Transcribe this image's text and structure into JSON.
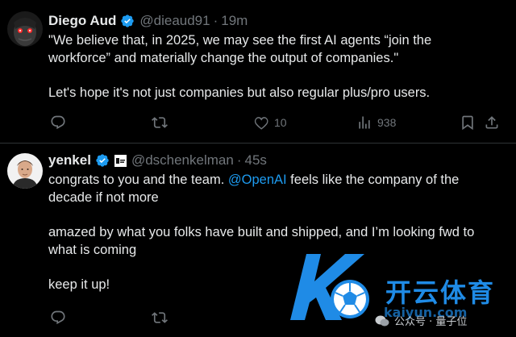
{
  "tweets": [
    {
      "display_name": "Diego Aud",
      "handle": "@dieaud91",
      "time": "19m",
      "lines": [
        "\"We believe that, in 2025, we may see the first AI agents “join the",
        "workforce” and materially change the output of companies.\"",
        "",
        "Let's hope it's not just companies but also regular plus/pro users."
      ],
      "actions": {
        "replies": "",
        "retweets": "",
        "likes": "10",
        "views": "938"
      },
      "icons": [
        "reply-icon",
        "retweet-icon",
        "like-icon",
        "views-icon",
        "bookmark-icon",
        "share-icon"
      ]
    },
    {
      "display_name": "yenkel",
      "handle": "@dschenkelman",
      "time": "45s",
      "line1_prefix": "congrats to you and the team. ",
      "line1_mention": "@OpenAI",
      "line1_suffix": " feels like the company of the",
      "lines": [
        "decade if not more",
        "",
        "amazed by what you folks have built and shipped, and I’m looking fwd to",
        "what is coming",
        "",
        "keep it up!"
      ],
      "actions": {
        "replies": "",
        "retweets": ""
      },
      "icons": [
        "reply-icon",
        "retweet-icon"
      ]
    }
  ],
  "watermark": {
    "brand": "开云体育",
    "domain": "kaiyun.com",
    "source": "公众号 · 量子位"
  },
  "colors": {
    "background": "#000000",
    "text": "#e7e9ea",
    "secondary": "#71767b",
    "accent": "#1d9bf0",
    "divider": "#2f3336"
  }
}
